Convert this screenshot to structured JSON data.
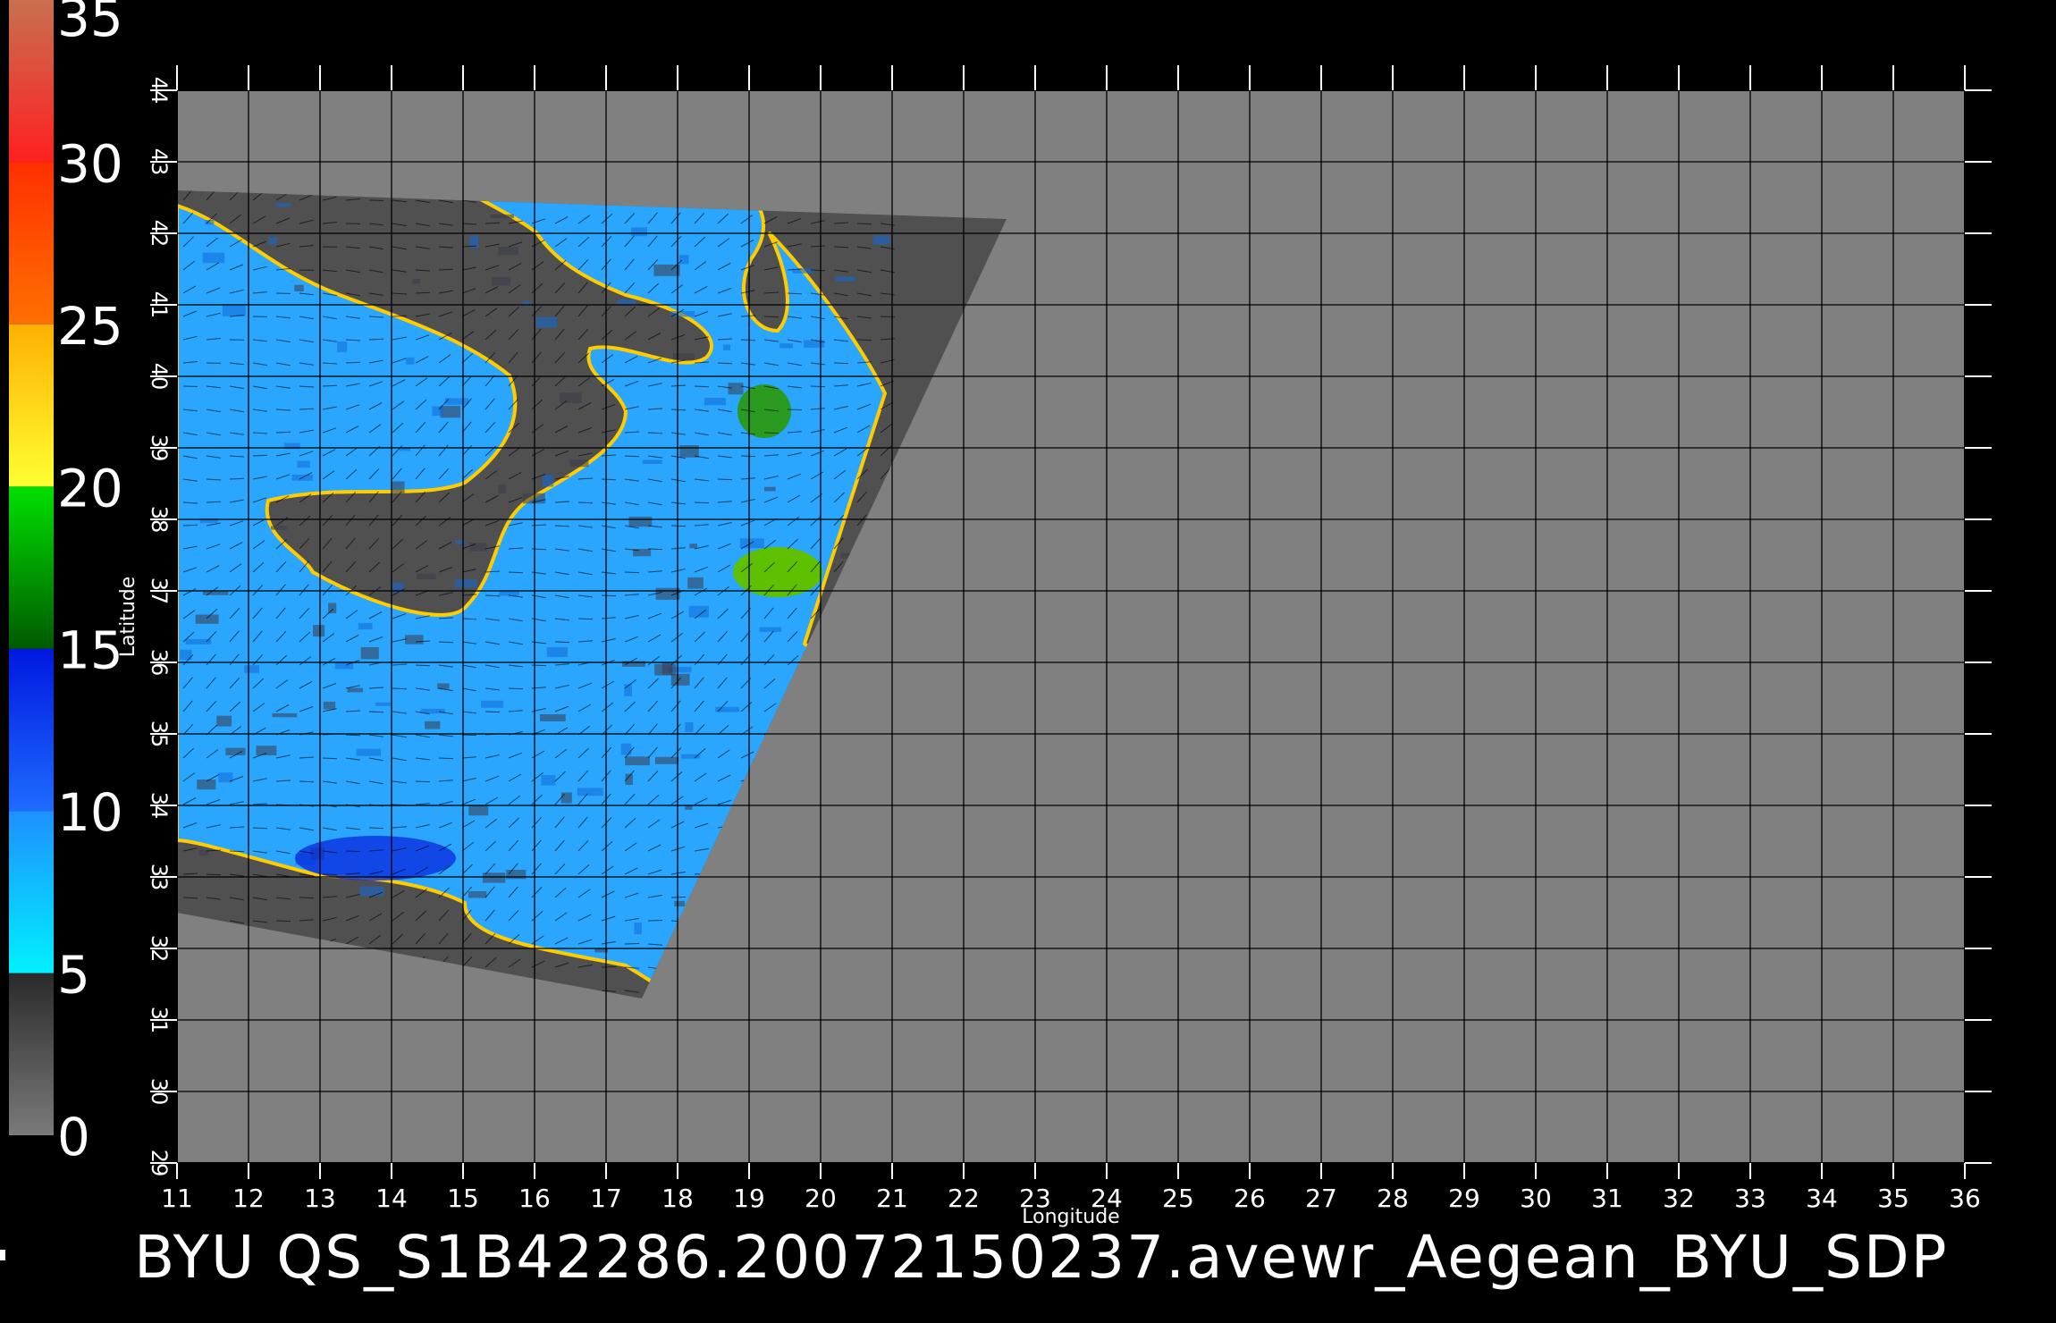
{
  "colorbar": {
    "ticks": [
      "0",
      "5",
      "10",
      "15",
      "20",
      "25",
      "30",
      "35"
    ],
    "bands": [
      {
        "from": 0,
        "to": 5,
        "colors": [
          "#7a7a7a",
          "#2a2a2a"
        ]
      },
      {
        "from": 5,
        "to": 10,
        "colors": [
          "#00f0ff",
          "#1e90ff"
        ]
      },
      {
        "from": 10,
        "to": 15,
        "colors": [
          "#1e6bff",
          "#0018e0"
        ]
      },
      {
        "from": 15,
        "to": 20,
        "colors": [
          "#005a00",
          "#00e000"
        ]
      },
      {
        "from": 20,
        "to": 25,
        "colors": [
          "#ffff33",
          "#ffb000"
        ]
      },
      {
        "from": 25,
        "to": 30,
        "colors": [
          "#ff7000",
          "#ff3000"
        ]
      },
      {
        "from": 30,
        "to": 35,
        "colors": [
          "#ff2020",
          "#c87050"
        ]
      }
    ]
  },
  "map": {
    "lon_range": [
      11,
      36
    ],
    "lat_range": [
      29,
      44
    ],
    "lon_ticks": [
      "11",
      "12",
      "13",
      "14",
      "15",
      "16",
      "17",
      "18",
      "19",
      "20",
      "21",
      "22",
      "23",
      "24",
      "25",
      "26",
      "27",
      "28",
      "29",
      "30",
      "31",
      "32",
      "33",
      "34",
      "35",
      "36"
    ],
    "lat_ticks": [
      "29",
      "30",
      "31",
      "32",
      "33",
      "34",
      "35",
      "36",
      "37",
      "38",
      "39",
      "40",
      "41",
      "42",
      "43",
      "44"
    ],
    "xlabel": "Longitude",
    "ylabel": "Latitude",
    "swath": [
      [
        22.6,
        42.2
      ],
      [
        11,
        42.6
      ],
      [
        11,
        32.5
      ],
      [
        17.5,
        31.3
      ]
    ],
    "no_data_color": "#808080",
    "swath_color": "#505050",
    "land_color": "#505050",
    "grid_color": "#000000"
  },
  "caption": "BYU  QS_S1B42286.20072150237.avewr_Aegean_BYU_SDP"
}
